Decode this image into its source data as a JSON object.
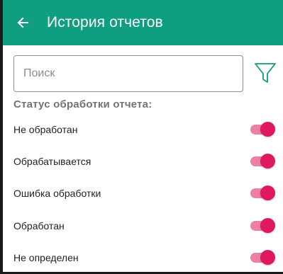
{
  "app_bar": {
    "title": "История отчетов",
    "back_icon": "arrow-left-icon",
    "background": "#0f9e80"
  },
  "search": {
    "placeholder": "Поиск",
    "value": "",
    "filter_icon": "funnel-icon"
  },
  "status_filter": {
    "header": "Статус обработки отчета:",
    "items": [
      {
        "label": "Не обработан",
        "enabled": true
      },
      {
        "label": "Обрабатывается",
        "enabled": true
      },
      {
        "label": "Ошибка обработки",
        "enabled": true
      },
      {
        "label": "Обработан",
        "enabled": true
      },
      {
        "label": "Не определен",
        "enabled": true
      }
    ]
  },
  "colors": {
    "toggle_thumb": "#e0185f",
    "toggle_track": "#ee7fa6",
    "accent_icon": "#0f9e80"
  }
}
